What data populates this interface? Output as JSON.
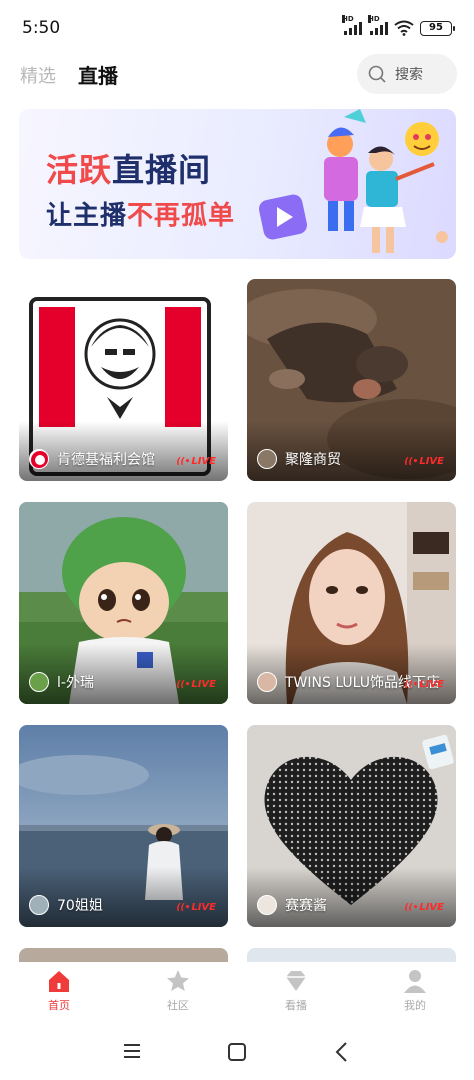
{
  "status_bar": {
    "time": "5:50",
    "signal_tag_1": "HD",
    "signal_tag_2": "HD",
    "battery": "95"
  },
  "header": {
    "tabs": [
      {
        "label": "精选"
      },
      {
        "label": "直播"
      }
    ],
    "search_label": "搜索"
  },
  "banner": {
    "line1_highlight": "活跃",
    "line1_rest": "直播间",
    "line2_start": "让主播",
    "line2_highlight": "不再孤单"
  },
  "live_badge": "LIVE",
  "streams": [
    {
      "name": "肯德基福利会馆"
    },
    {
      "name": "聚隆商贸"
    },
    {
      "name": "l-外瑞"
    },
    {
      "name": "TWINS LULU饰品线下店"
    },
    {
      "name": "70姐姐"
    },
    {
      "name": "赛赛酱"
    }
  ],
  "bottom_nav": [
    {
      "label": "首页",
      "icon": "home-icon",
      "active": true
    },
    {
      "label": "社区",
      "icon": "star-icon",
      "active": false
    },
    {
      "label": "看播",
      "icon": "diamond-icon",
      "active": false
    },
    {
      "label": "我的",
      "icon": "person-icon",
      "active": false
    }
  ],
  "colors": {
    "accent": "#f03b3b",
    "live_red": "#ff2a2a",
    "banner_navy": "#1f2f6b"
  }
}
